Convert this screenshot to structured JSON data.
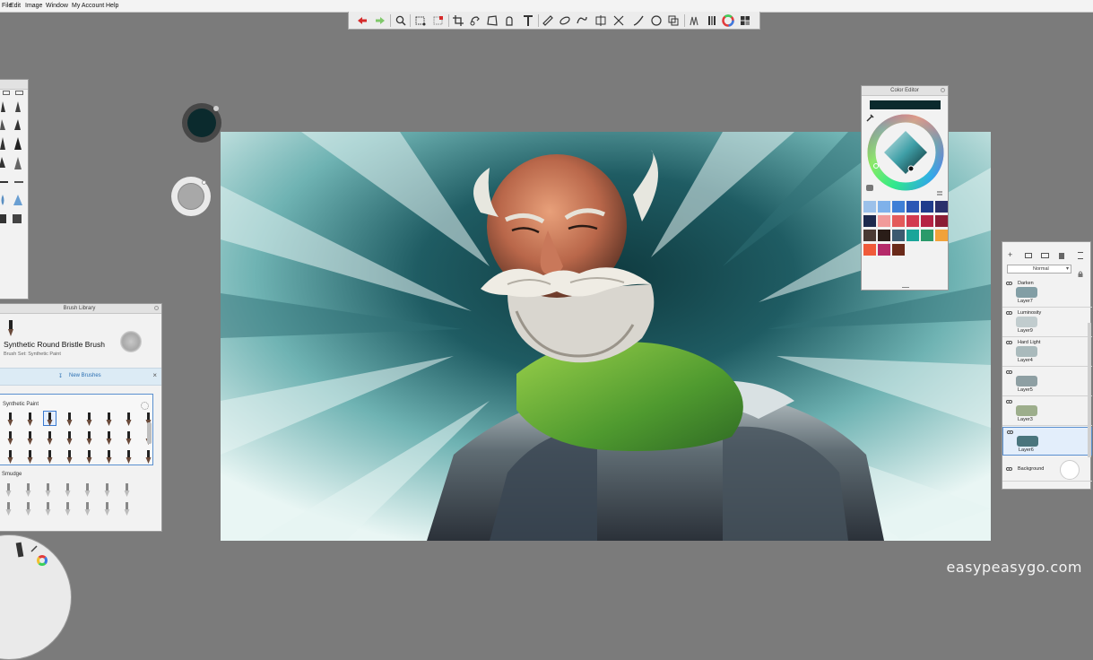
{
  "menu": {
    "items": [
      "File",
      "Edit",
      "Image",
      "Window",
      "My Account",
      "Help"
    ]
  },
  "toolbar": {
    "tools": [
      "undo-icon",
      "redo-icon",
      "zoom-icon",
      "lasso-select-icon",
      "magic-wand-icon",
      "crop-icon",
      "transform-icon",
      "distort-icon",
      "stamp-icon",
      "text-icon",
      "ruler-icon",
      "ellipse-guide-icon",
      "french-curve-icon",
      "symmetry-icon",
      "perspective-icon",
      "stroke-icon",
      "shape-icon",
      "fill-icon",
      "brush-library-icon",
      "color-wheel-icon",
      "copic-icon"
    ]
  },
  "color_editor": {
    "title": "Color Editor",
    "current_color": "#0b2a2d",
    "swatches": [
      "#9cc1ea",
      "#7fb1ea",
      "#3f7fd6",
      "#2b57b5",
      "#1f3b8c",
      "#2a2f6b",
      "#1d2a4d",
      "#f19a9a",
      "#e35a5a",
      "#d23a4f",
      "#b52243",
      "#8b1d35",
      "#4a3a34",
      "#2a1d18",
      "#3c5a70",
      "#1aa59a",
      "#2a9a6a",
      "#f1a23a",
      "#f05a3a",
      "#b52a6a",
      "#6a2a1a"
    ]
  },
  "brush_library": {
    "title": "Brush Library",
    "brush_name": "Synthetic Round Bristle Brush",
    "brush_set": "Brush Set: Synthetic Paint",
    "new_brushes": "New Brushes",
    "set1": "Synthetic Paint",
    "set2": "Smudge"
  },
  "layers": {
    "blend_mode": "Normal",
    "rows": [
      {
        "mode": "Darken",
        "name": "Layer7"
      },
      {
        "mode": "Luminosity",
        "name": "Layer9"
      },
      {
        "mode": "Hard Light",
        "name": "Layer4"
      },
      {
        "mode": "",
        "name": "Layer5"
      },
      {
        "mode": "",
        "name": "Layer3"
      },
      {
        "mode": "",
        "name": "Layer6"
      }
    ],
    "background": "Background"
  },
  "watermark": "easypeasygo.com"
}
